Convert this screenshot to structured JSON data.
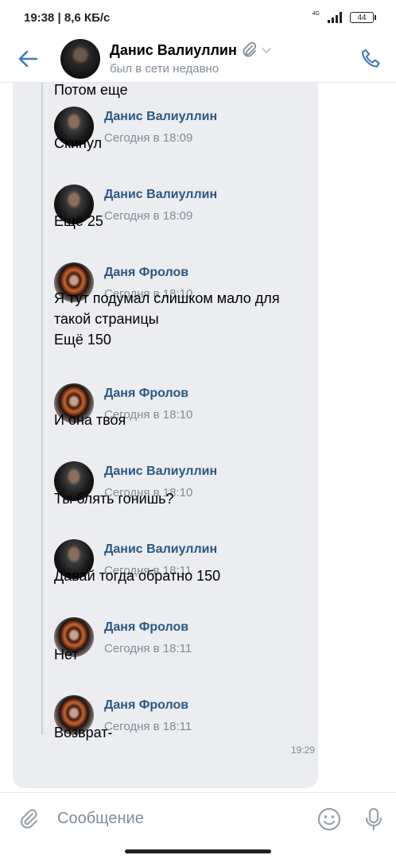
{
  "status_bar": {
    "time_speed": "19:38 | 8,6 КБ/с",
    "network": "4G",
    "battery": "44"
  },
  "header": {
    "name": "Данис Валиуллин",
    "status": "был в сети недавно"
  },
  "messages": [
    {
      "kind": "text",
      "text": "Потом еще"
    },
    {
      "kind": "author",
      "author": "Данис Валиуллин",
      "time": "Сегодня в 18:09",
      "avatar": "danis"
    },
    {
      "kind": "text",
      "text": "Скинул"
    },
    {
      "kind": "author",
      "author": "Данис Валиуллин",
      "time": "Сегодня в 18:09",
      "avatar": "danis"
    },
    {
      "kind": "text",
      "text": "Ещё 25"
    },
    {
      "kind": "author",
      "author": "Даня Фролов",
      "time": "Сегодня в 18:10",
      "avatar": "frolov"
    },
    {
      "kind": "text",
      "text": "Я тут подумал слишком мало для\nтакой страницы\nЕщё 150"
    },
    {
      "kind": "author",
      "author": "Даня Фролов",
      "time": "Сегодня в 18:10",
      "avatar": "frolov"
    },
    {
      "kind": "text",
      "text": "И она твоя"
    },
    {
      "kind": "author",
      "author": "Данис Валиуллин",
      "time": "Сегодня в 18:10",
      "avatar": "danis"
    },
    {
      "kind": "text",
      "text": "Ты блять гонишь?"
    },
    {
      "kind": "author",
      "author": "Данис Валиуллин",
      "time": "Сегодня в 18:11",
      "avatar": "danis"
    },
    {
      "kind": "text",
      "text": "Давай тогда обратно 150"
    },
    {
      "kind": "author",
      "author": "Даня Фролов",
      "time": "Сегодня в 18:11",
      "avatar": "frolov"
    },
    {
      "kind": "text",
      "text": "Нет"
    },
    {
      "kind": "author",
      "author": "Даня Фролов",
      "time": "Сегодня в 18:11",
      "avatar": "frolov"
    },
    {
      "kind": "text",
      "text": "Возврат-"
    }
  ],
  "bubble_time": "19:29",
  "composer": {
    "placeholder": "Сообщение"
  },
  "colors": {
    "accent": "#2a5885",
    "icon": "#447bba",
    "muted": "#818c99",
    "bubble": "#ebedf0"
  }
}
